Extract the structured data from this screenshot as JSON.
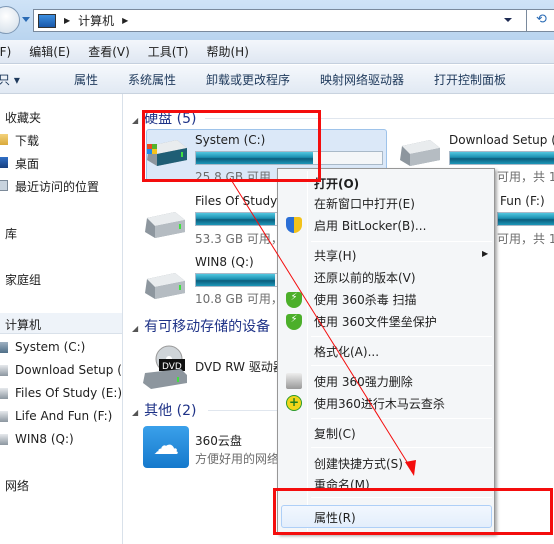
{
  "address": {
    "crumbs": [
      "计算机"
    ],
    "refresh_icon": "refresh-icon"
  },
  "menubar": [
    "(F)",
    "编辑(E)",
    "查看(V)",
    "工具(T)",
    "帮助(H)"
  ],
  "toolbar": [
    "只 ▾",
    "属性",
    "系统属性",
    "卸载或更改程序",
    "映射网络驱动器",
    "打开控制面板"
  ],
  "sidebar": {
    "favorites": {
      "label": "收藏夹",
      "items": [
        "下载",
        "桌面",
        "最近访问的位置"
      ]
    },
    "libraries": "库",
    "homegroup": "家庭组",
    "computer": {
      "label": "计算机",
      "items": [
        "System (C:)",
        "Download Setup (",
        "Files Of Study (E:)",
        "Life And Fun (F:)",
        "WIN8 (Q:)"
      ]
    },
    "network": "网络"
  },
  "main": {
    "hard_disks": {
      "header": "硬盘 (5)",
      "drives": [
        {
          "name": "System (C:)",
          "free": "25.8 GB 可用",
          "used_fraction": 0.63
        },
        {
          "name": "Download Setup (",
          "free": "可用，共 1",
          "used_fraction": 0.9
        },
        {
          "name": "Files Of Study",
          "free": "53.3 GB 可用，",
          "used_fraction": 0.9
        },
        {
          "name": "Fun (F:)",
          "free": "可用，共 1",
          "used_fraction": 0.9
        },
        {
          "name": "WIN8 (Q:)",
          "free": "10.8 GB 可用，",
          "used_fraction": 0.9
        }
      ]
    },
    "removable": {
      "header": "有可移动存储的设备",
      "items": [
        {
          "name": "DVD RW 驱动器"
        }
      ]
    },
    "other": {
      "header": "其他 (2)",
      "items": [
        {
          "name": "360云盘",
          "desc": "方便好用的网络"
        }
      ]
    }
  },
  "context_menu": {
    "items": [
      {
        "label": "打开(O)",
        "bold": true
      },
      {
        "label": "在新窗口中打开(E)"
      },
      {
        "label": "启用 BitLocker(B)...",
        "icon": "uac-shield-icon"
      },
      {
        "label": "共享(H)",
        "submenu": true
      },
      {
        "label": "还原以前的版本(V)"
      },
      {
        "label": "使用 360杀毒 扫描",
        "icon": "360-antivirus-icon"
      },
      {
        "label": "使用 360文件堡垒保护",
        "icon": "360-antivirus-icon"
      },
      {
        "label": "格式化(A)..."
      },
      {
        "label": "使用 360强力删除",
        "icon": "shredder-icon"
      },
      {
        "label": "使用360进行木马云查杀",
        "icon": "360-cloud-scan-icon"
      },
      {
        "label": "复制(C)"
      },
      {
        "label": "创建快捷方式(S)"
      },
      {
        "label": "重命名(M)"
      },
      {
        "label": "属性(R)",
        "highlighted": true
      }
    ]
  },
  "annotation_color": "#f40d0d"
}
